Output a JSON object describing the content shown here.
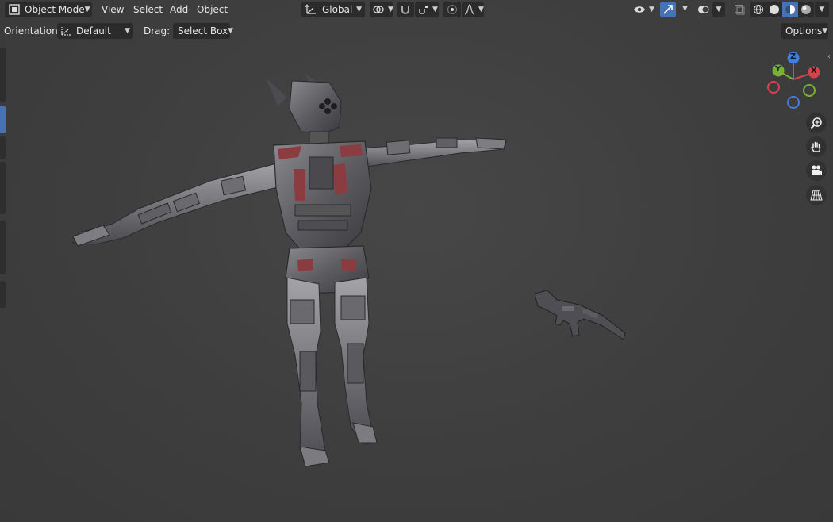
{
  "header": {
    "mode_label": "Object Mode",
    "menus": [
      "View",
      "Select",
      "Add",
      "Object"
    ],
    "transform_orientation": "Global",
    "options_label": "Options"
  },
  "toolbar": {
    "orientation_label": "Orientation:",
    "orientation_value": "Default",
    "drag_label": "Drag:",
    "drag_value": "Select Box"
  },
  "gizmo": {
    "x": "X",
    "y": "Y",
    "z": "Z",
    "colors": {
      "x": "#d6434f",
      "y": "#79b038",
      "z": "#3f7fe0"
    }
  },
  "nav_icons": [
    "zoom-icon",
    "hand-pan-icon",
    "camera-icon",
    "perspective-grid-icon"
  ],
  "scene_objects": [
    "robot-character-model",
    "rifle-model"
  ],
  "accent": "#4772b3"
}
